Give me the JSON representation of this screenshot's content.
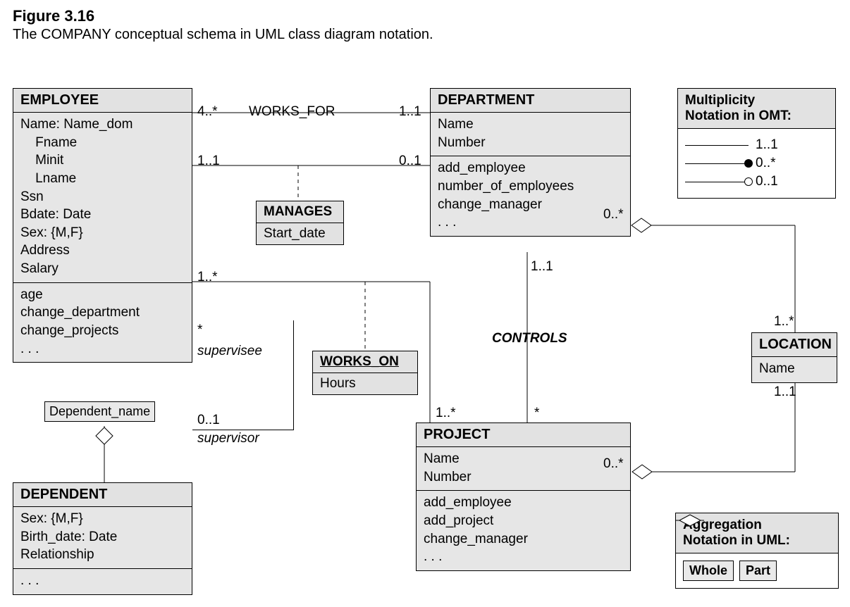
{
  "figure": {
    "num": "Figure 3.16",
    "caption": "The COMPANY conceptual schema in UML class diagram notation."
  },
  "classes": {
    "employee": {
      "title": "EMPLOYEE",
      "attrs": [
        "Name: Name_dom",
        "    Fname",
        "    Minit",
        "    Lname",
        "Ssn",
        "Bdate: Date",
        "Sex: {M,F}",
        "Address",
        "Salary"
      ],
      "ops": [
        "age",
        "change_department",
        "change_projects",
        ". . ."
      ]
    },
    "department": {
      "title": "DEPARTMENT",
      "attrs": [
        "Name",
        "Number"
      ],
      "ops": [
        "add_employee",
        "number_of_employees",
        "change_manager",
        ". . ."
      ]
    },
    "project": {
      "title": "PROJECT",
      "attrs": [
        "Name",
        "Number"
      ],
      "ops": [
        "add_employee",
        "add_project",
        "change_manager",
        ". . ."
      ]
    },
    "location": {
      "title": "LOCATION",
      "attrs": [
        "Name"
      ]
    },
    "dependent": {
      "title": "DEPENDENT",
      "attrs": [
        "Sex: {M,F}",
        "Birth_date: Date",
        "Relationship"
      ],
      "ops": [
        ". . ."
      ]
    }
  },
  "assoc_classes": {
    "manages": {
      "title": "MANAGES",
      "attr": "Start_date"
    },
    "works_on": {
      "title": "WORKS_ON",
      "attr": "Hours"
    }
  },
  "labels": {
    "works_for": "WORKS_FOR",
    "controls": "CONTROLS",
    "supervisee": "supervisee",
    "supervisor": "supervisor",
    "qualifier": "Dependent_name"
  },
  "mult": {
    "wf_emp": "4..*",
    "wf_dept": "1..1",
    "mg_emp": "1..1",
    "mg_dept": "0..1",
    "wo_emp": "1..*",
    "wo_proj": "1..*",
    "ctrl_dept": "1..1",
    "ctrl_proj": "*",
    "sup_sup": "0..1",
    "sup_sub": "*",
    "deptloc_dept": "0..*",
    "deptloc_loc": "1..*",
    "projloc_proj": "0..*",
    "projloc_loc": "1..1"
  },
  "legend": {
    "title1": "Multiplicity",
    "title2": "Notation in OMT:",
    "r1": "1..1",
    "r2": "0..*",
    "r3": "0..1",
    "agg_title1": "Aggregation",
    "agg_title2": "Notation in UML:",
    "whole": "Whole",
    "part": "Part"
  }
}
